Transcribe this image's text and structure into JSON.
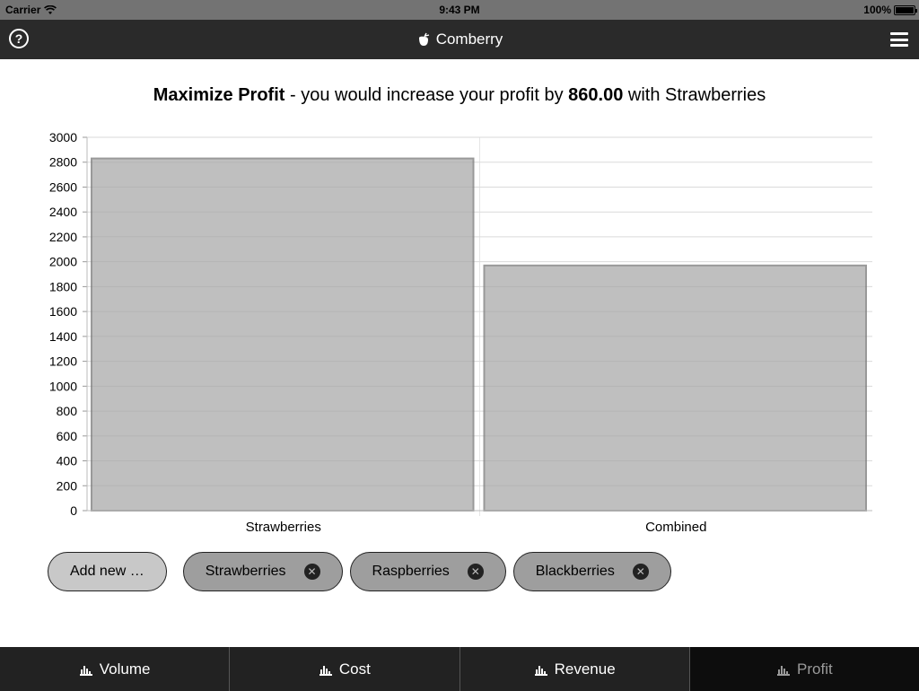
{
  "status": {
    "carrier": "Carrier",
    "time": "9:43 PM",
    "battery": "100%"
  },
  "nav": {
    "title": "Comberry",
    "help_symbol": "?"
  },
  "heading": {
    "bold_start": "Maximize Profit",
    "middle": " - you would increase your profit by ",
    "bold_value": "860.00",
    "end": " with Strawberries"
  },
  "chart_data": {
    "type": "bar",
    "title": "",
    "xlabel": "",
    "ylabel": "",
    "categories": [
      "Strawberries",
      "Combined"
    ],
    "values": [
      2830,
      1970
    ],
    "ylim": [
      0,
      3000
    ],
    "yticks": [
      0,
      200,
      400,
      600,
      800,
      1000,
      1200,
      1400,
      1600,
      1800,
      2000,
      2200,
      2400,
      2600,
      2800,
      3000
    ],
    "grid": true,
    "bar_color": "#bfbfbf",
    "bar_border": "#999999"
  },
  "chips": {
    "add_label": "Add new …",
    "fruits": [
      "Strawberries",
      "Raspberries",
      "Blackberries"
    ]
  },
  "tabs": [
    {
      "label": "Volume",
      "active": false
    },
    {
      "label": "Cost",
      "active": false
    },
    {
      "label": "Revenue",
      "active": false
    },
    {
      "label": "Profit",
      "active": true
    }
  ],
  "icons": {
    "help": "help-icon",
    "menu": "menu-icon",
    "logo": "berry-logo-icon",
    "tab": "bar-chart-icon",
    "remove": "remove-icon"
  }
}
